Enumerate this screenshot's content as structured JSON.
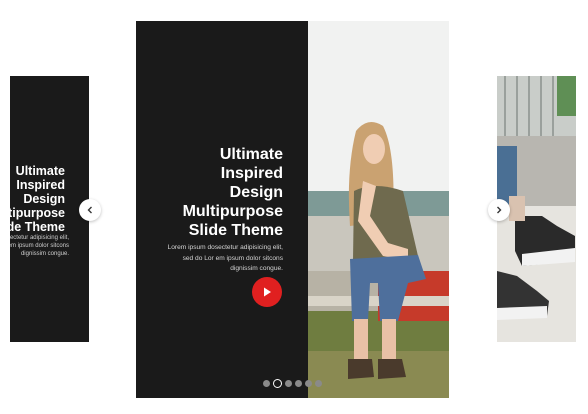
{
  "left_card": {
    "title_lines": [
      "Ultimate",
      "Inspired",
      "Design",
      "Multipurpose",
      "Slide Theme"
    ],
    "desc_lines": [
      "Lorem ipsum dosectetur adipisicing elit,",
      "sed do Lor em ipsum dolor sitcons",
      "dignissim congue."
    ]
  },
  "center_card": {
    "title_lines": [
      "Ultimate",
      "Inspired",
      "Design",
      "Multipurpose",
      "Slide Theme"
    ],
    "desc_lines": [
      "Lorem ipsum dosectetur adipisicing elit,",
      "sed do Lor em ipsum dolor sitcons",
      "dignissim congue."
    ],
    "play_icon": "play-icon",
    "dots": {
      "count": 6,
      "active_index": 1
    }
  },
  "navigation": {
    "prev_icon": "chevron-left-icon",
    "next_icon": "chevron-right-icon"
  },
  "colors": {
    "card_background": "#1a1a1a",
    "play_button": "#e02020",
    "page_background": "#ffffff"
  }
}
